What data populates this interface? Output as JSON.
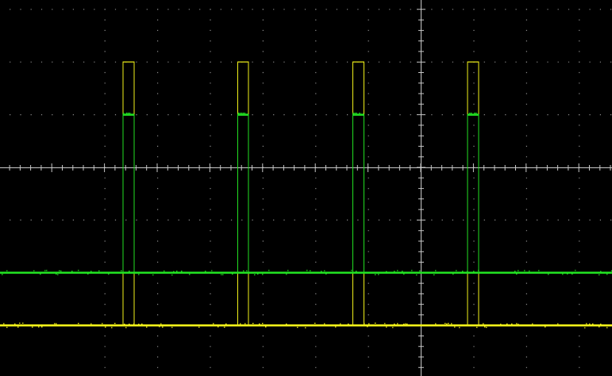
{
  "chart_data": {
    "type": "line",
    "title": "",
    "xlabel": "",
    "ylabel": "",
    "grid": true,
    "xlim": [
      -6.6,
      3.0
    ],
    "ylim": [
      -4.0,
      3.2
    ],
    "series": [
      {
        "color": "#f2f21a",
        "low": -3.0,
        "high": 2.0,
        "pulses": [
          [
            -5.65,
            -5.44
          ],
          [
            -3.47,
            -3.27
          ],
          [
            -1.29,
            -1.08
          ],
          [
            0.89,
            1.1
          ]
        ]
      },
      {
        "color": "#22e022",
        "low": -2.0,
        "high": 1.0,
        "pulses": [
          [
            -5.65,
            -5.44
          ],
          [
            -3.47,
            -3.27
          ],
          [
            -1.29,
            -1.08
          ],
          [
            0.89,
            1.1
          ]
        ]
      }
    ]
  }
}
